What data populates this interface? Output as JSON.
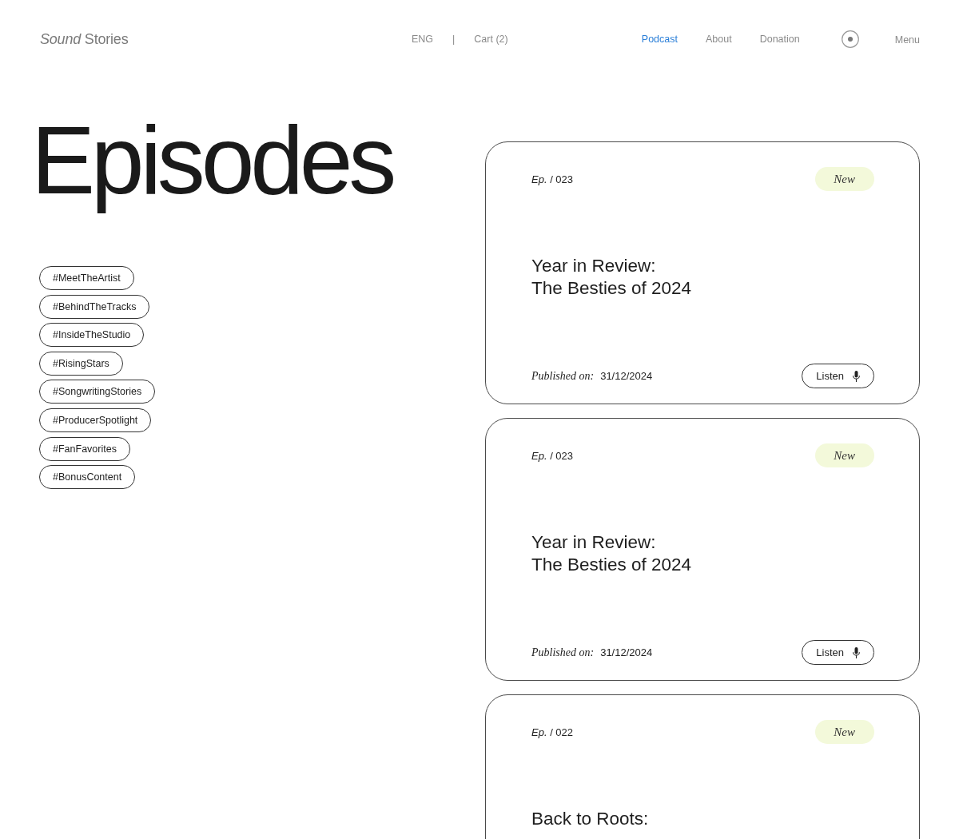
{
  "header": {
    "logo": "*Sound* Stories",
    "language": "ENG",
    "separator": "|",
    "cart": "Cart (2)",
    "nav": [
      {
        "label": "Podcast",
        "selected": true
      },
      {
        "label": "About",
        "selected": false
      },
      {
        "label": "Donation",
        "selected": false
      }
    ],
    "menu": "Menu"
  },
  "page_title": "Episodes",
  "tags": [
    "#MeetTheArtist",
    "#BehindTheTracks",
    "#InsideTheStudio",
    "#RisingStars",
    "#SongwritingStories",
    "#ProducerSpotlight",
    "#FanFavorites",
    "#BonusContent"
  ],
  "episodes": [
    {
      "number": "*Ep.* / 023",
      "badge": "New",
      "title_lines": [
        "Year in Review:",
        "The Besties of 2024"
      ],
      "published_label": "Published on:",
      "published_date": "31/12/2024",
      "button": "Listen"
    },
    {
      "number": "*Ep.* / 023",
      "badge": "New",
      "title_lines": [
        "Year in Review:",
        "The Besties of 2024"
      ],
      "published_label": "Published on:",
      "published_date": "31/12/2024",
      "button": "Listen"
    },
    {
      "number": "*Ep.* / 022",
      "badge": "New",
      "title_lines": [
        "Back to Roots:"
      ]
    }
  ]
}
